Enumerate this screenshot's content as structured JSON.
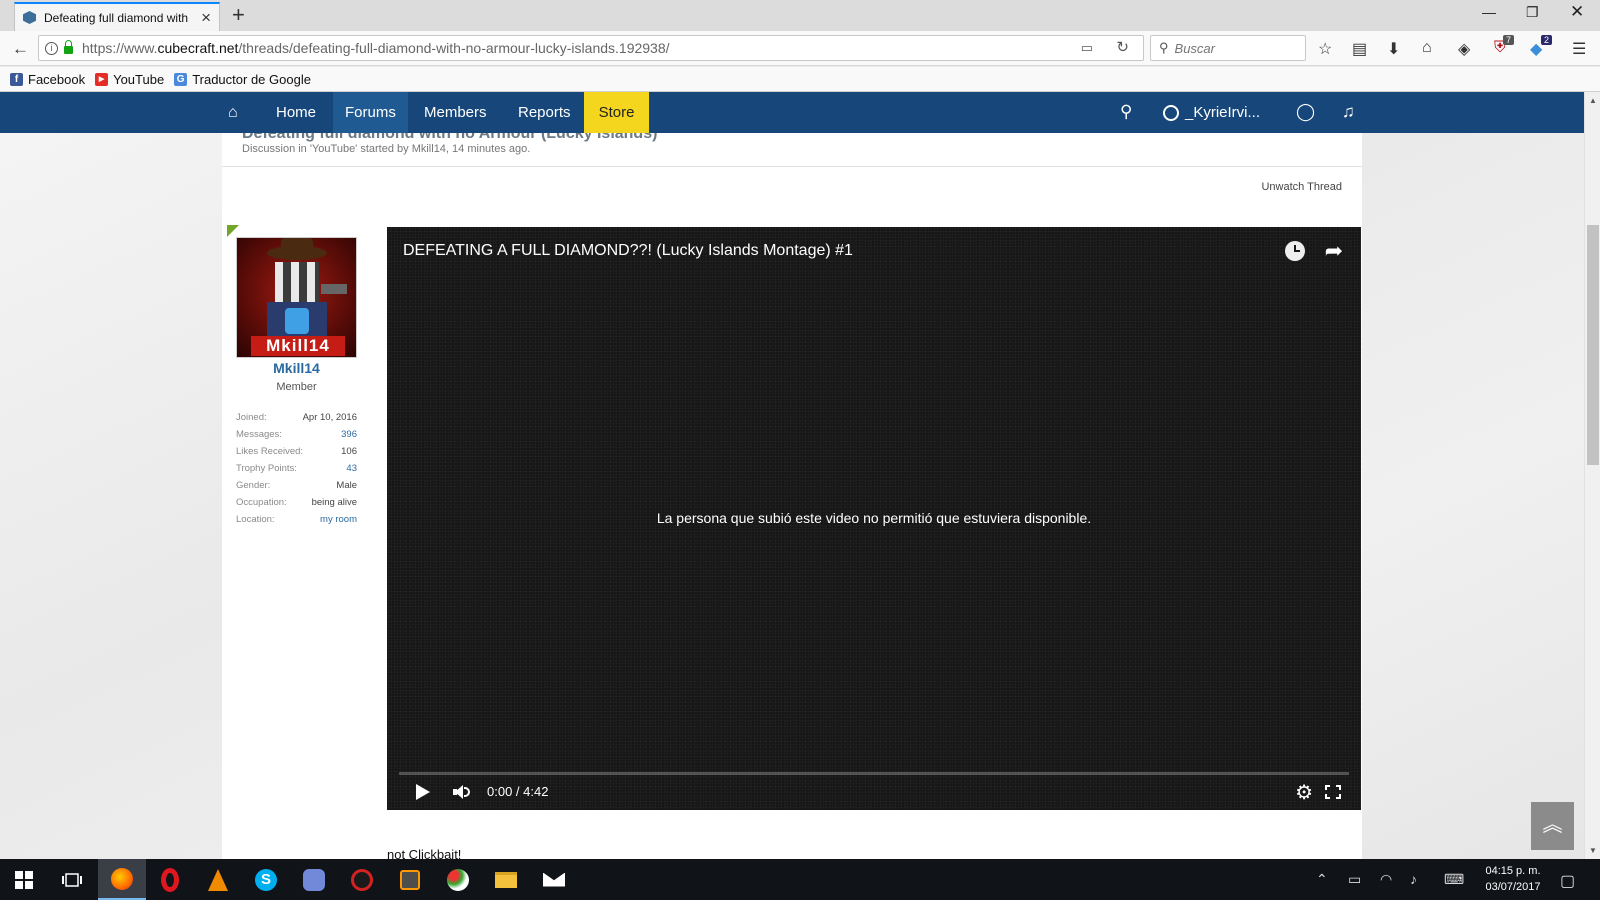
{
  "browser": {
    "tab_title": "Defeating full diamond with",
    "url_prefix": "https://www.",
    "url_domain": "cubecraft.net",
    "url_path": "/threads/defeating-full-diamond-with-no-armour-lucky-islands.192938/",
    "search_placeholder": "Buscar",
    "badge_ublock": "7",
    "badge_ext": "2",
    "bookmarks": [
      {
        "label": "Facebook",
        "icon": "facebook-icon",
        "color": "#3b5998",
        "glyph": "f"
      },
      {
        "label": "YouTube",
        "icon": "youtube-icon",
        "color": "#e52d27",
        "glyph": "▶"
      },
      {
        "label": "Traductor de Google",
        "icon": "google-translate-icon",
        "color": "#4a89dc",
        "glyph": "G"
      }
    ]
  },
  "site_nav": {
    "items": [
      {
        "label": "Home"
      },
      {
        "label": "Forums"
      },
      {
        "label": "Members"
      },
      {
        "label": "Reports"
      },
      {
        "label": "Store"
      }
    ],
    "username": "_KyrieIrvi..."
  },
  "thread": {
    "title": "Defeating full diamond with no Armour (Lucky Islands)",
    "meta": "Discussion in 'YouTube' started by Mkill14, 14 minutes ago.",
    "unwatch_label": "Unwatch Thread"
  },
  "author": {
    "avatar_text": "Mkill14",
    "username": "Mkill14",
    "title": "Member",
    "info": [
      {
        "key": "Joined:",
        "value": "Apr 10, 2016",
        "link": false
      },
      {
        "key": "Messages:",
        "value": "396",
        "link": true
      },
      {
        "key": "Likes Received:",
        "value": "106",
        "link": false
      },
      {
        "key": "Trophy Points:",
        "value": "43",
        "link": true
      },
      {
        "key": "Gender:",
        "value": "Male",
        "link": false
      },
      {
        "key": "Occupation:",
        "value": "being alive",
        "link": false
      },
      {
        "key": "Location:",
        "value": "my room",
        "link": true
      }
    ]
  },
  "video": {
    "title": "DEFEATING A FULL DIAMOND??! (Lucky Islands Montage) #1",
    "message": "La persona que subió este video no permitió que estuviera disponible.",
    "time": "0:00 / 4:42"
  },
  "post": {
    "text": "not Clickbait!"
  },
  "taskbar": {
    "time": "04:15 p. m.",
    "date": "03/07/2017"
  },
  "colors": {
    "site_nav": "#17477a",
    "store": "#f5d61e",
    "link": "#2b6aa0"
  }
}
